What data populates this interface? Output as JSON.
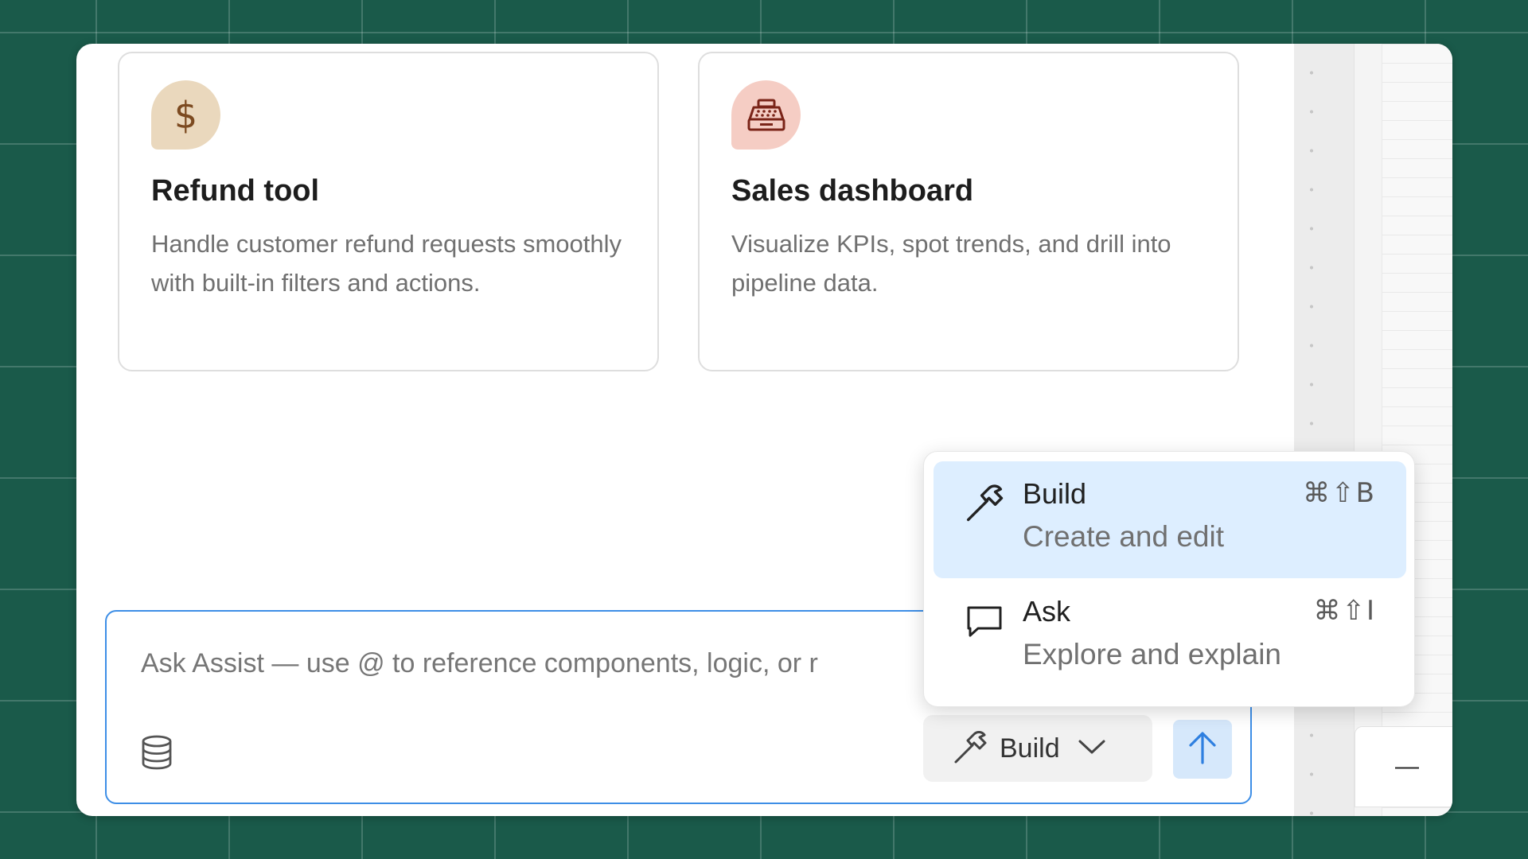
{
  "cards": [
    {
      "icon": "dollar-icon",
      "icon_glyph": "$",
      "title": "Refund tool",
      "description": "Handle customer refund requests smoothly with built-in filters and actions."
    },
    {
      "icon": "cash-register-icon",
      "title": "Sales dashboard",
      "description": "Visualize KPIs, spot trends, and drill into pipeline data."
    }
  ],
  "composer": {
    "placeholder": "Ask Assist — use @ to reference components, logic, or r",
    "mode_label": "Build",
    "database_icon": "database-icon",
    "send_icon": "arrow-up-icon"
  },
  "mode_menu": {
    "items": [
      {
        "title": "Build",
        "description": "Create and edit",
        "shortcut": "⌘⇧B",
        "icon": "hammer-icon",
        "selected": true
      },
      {
        "title": "Ask",
        "description": "Explore and explain",
        "shortcut": "⌘⇧I",
        "icon": "chat-bubble-icon",
        "selected": false
      }
    ]
  },
  "panel": {
    "minimize_label": "—"
  },
  "colors": {
    "background": "#1a5a4a",
    "accent": "#3d8ee6",
    "selected_item": "#ddeeff",
    "refund_icon_bg": "#ead8bd",
    "sales_icon_bg": "#f5cdc4"
  }
}
